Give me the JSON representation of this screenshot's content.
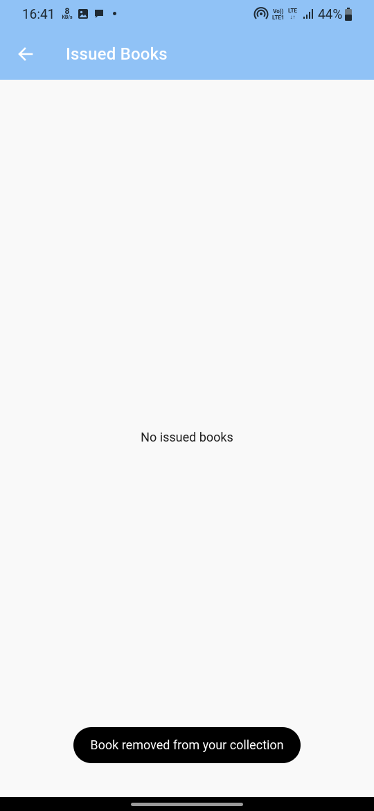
{
  "status_bar": {
    "time": "16:41",
    "net_speed_value": "8",
    "net_speed_unit": "KB/s",
    "volte_top": "Vo))",
    "volte_bottom": "LTE1",
    "lte_top": "LTE",
    "lte_bottom": "↓↑",
    "battery": "44%",
    "icons": [
      "gallery-icon",
      "chat-icon",
      "dot-icon",
      "hotspot-icon",
      "signal-icon",
      "battery-icon"
    ]
  },
  "app_bar": {
    "title": "Issued Books",
    "back_icon": "arrow-left-icon",
    "color": "#90c2f6"
  },
  "content": {
    "empty_message": "No issued books"
  },
  "snackbar": {
    "message": "Book removed from your collection"
  }
}
